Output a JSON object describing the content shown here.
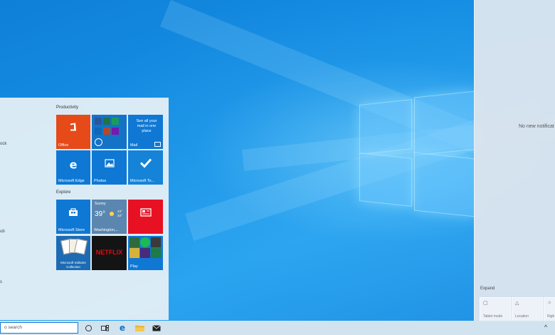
{
  "start_menu": {
    "left_fragments": [
      "ock",
      "ub",
      "s"
    ],
    "groups": [
      {
        "title": "Productivity"
      },
      {
        "title": "Explore"
      }
    ],
    "tiles": {
      "office": "Office",
      "mail_text": "See all your mail in one place",
      "mail": "Mail",
      "edge": "Microsoft Edge",
      "photos": "Photos",
      "todo": "Microsoft To...",
      "store": "Microsoft Store",
      "weather_cond": "Sunny",
      "weather_temp": "39°",
      "weather_hilo": "43°\n33°",
      "weather_city": "Washington,...",
      "solitaire": "Microsoft Solitaire Collection",
      "netflix": "NETFLIX",
      "play": "Play"
    }
  },
  "action_center": {
    "no_notifications": "No new notificat",
    "expand": "Expand",
    "quick_actions": [
      {
        "label": "Tablet mode"
      },
      {
        "label": "Location"
      },
      {
        "label": "Nigh"
      }
    ]
  },
  "taskbar": {
    "search_placeholder": "o search",
    "icons": [
      "cortana-icon",
      "task-view-icon",
      "edge-icon",
      "file-explorer-icon",
      "mail-icon"
    ],
    "tray_chevron": "^"
  }
}
